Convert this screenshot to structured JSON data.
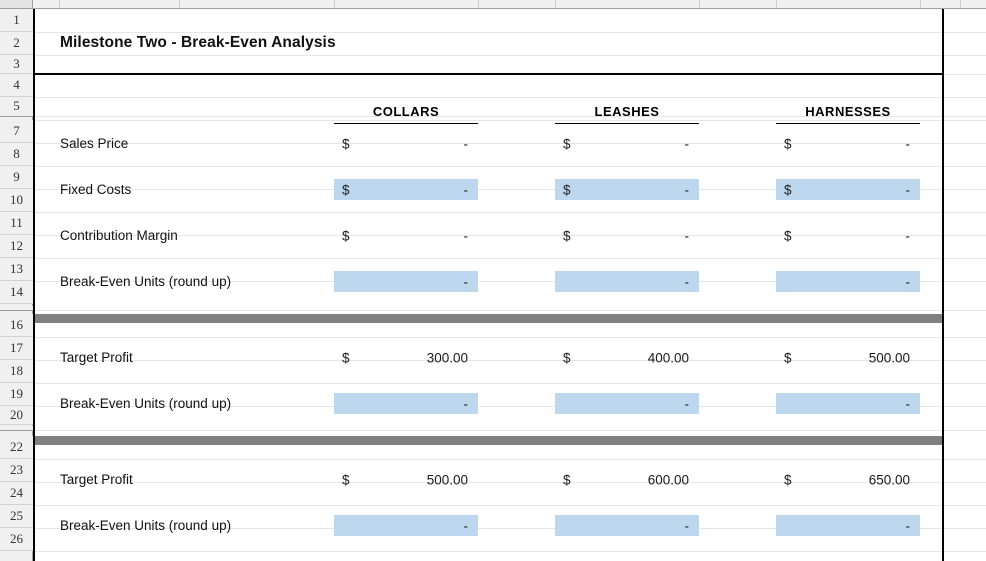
{
  "app": {
    "type": "spreadsheet",
    "colors": {
      "input_fill": "#bdd7ee",
      "separator_bar": "#808080",
      "gutter": "#f0f0f0",
      "frame_border": "#000000"
    }
  },
  "gutter": {
    "rows": [
      "1",
      "2",
      "3",
      "4",
      "5",
      "7",
      "8",
      "9",
      "10",
      "11",
      "12",
      "13",
      "14",
      "16",
      "17",
      "18",
      "19",
      "20",
      "22",
      "23",
      "24",
      "25",
      "26"
    ],
    "hidden_markers": [
      "6",
      "15",
      "21"
    ]
  },
  "sheet": {
    "title": "Milestone Two - Break-Even Analysis",
    "column_headers": [
      "COLLARS",
      "LEASHES",
      "HARNESSES"
    ],
    "section_one": {
      "rows": [
        {
          "label": "Sales Price",
          "highlighted": false,
          "cells": [
            {
              "symbol": "$",
              "value": "-"
            },
            {
              "symbol": "$",
              "value": "-"
            },
            {
              "symbol": "$",
              "value": "-"
            }
          ]
        },
        {
          "label": "Fixed Costs",
          "highlighted": true,
          "cells": [
            {
              "symbol": "$",
              "value": "-"
            },
            {
              "symbol": "$",
              "value": "-"
            },
            {
              "symbol": "$",
              "value": "-"
            }
          ]
        },
        {
          "label": "Contribution Margin",
          "highlighted": false,
          "cells": [
            {
              "symbol": "$",
              "value": "-"
            },
            {
              "symbol": "$",
              "value": "-"
            },
            {
              "symbol": "$",
              "value": "-"
            }
          ]
        },
        {
          "label": "Break-Even Units (round up)",
          "highlighted": true,
          "cells": [
            {
              "symbol": "",
              "value": "-"
            },
            {
              "symbol": "",
              "value": "-"
            },
            {
              "symbol": "",
              "value": "-"
            }
          ]
        }
      ]
    },
    "section_two": {
      "rows": [
        {
          "label": "Target Profit",
          "highlighted": false,
          "cells": [
            {
              "symbol": "$",
              "value": "300.00"
            },
            {
              "symbol": "$",
              "value": "400.00"
            },
            {
              "symbol": "$",
              "value": "500.00"
            }
          ]
        },
        {
          "label": "Break-Even Units (round up)",
          "highlighted": true,
          "cells": [
            {
              "symbol": "",
              "value": "-"
            },
            {
              "symbol": "",
              "value": "-"
            },
            {
              "symbol": "",
              "value": "-"
            }
          ]
        }
      ]
    },
    "section_three": {
      "rows": [
        {
          "label": "Target Profit",
          "highlighted": false,
          "cells": [
            {
              "symbol": "$",
              "value": "500.00"
            },
            {
              "symbol": "$",
              "value": "600.00"
            },
            {
              "symbol": "$",
              "value": "650.00"
            }
          ]
        },
        {
          "label": "Break-Even Units (round up)",
          "highlighted": true,
          "cells": [
            {
              "symbol": "",
              "value": "-"
            },
            {
              "symbol": "",
              "value": "-"
            },
            {
              "symbol": "",
              "value": "-"
            }
          ]
        }
      ]
    }
  }
}
